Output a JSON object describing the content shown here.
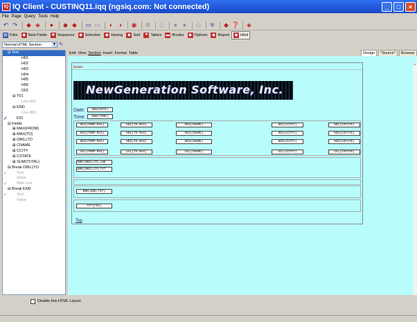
{
  "window": {
    "title": "IQ Client - CUSTINQ11.iqq  (ngsiq.com: Not connected)",
    "icon_label": "IQ"
  },
  "menu": [
    "File",
    "Page",
    "Query",
    "Tools",
    "Help"
  ],
  "toolbar2": [
    "Files",
    "New Fields",
    "Sequence",
    "Selection",
    "Having",
    "Sort",
    "Tables",
    "Breaks",
    "Options",
    "Report",
    "Html"
  ],
  "section_select": {
    "value": "Normal HTML Section"
  },
  "tree": [
    {
      "label": "Text",
      "indent": 1,
      "selected": true,
      "toggle": "⊟"
    },
    {
      "label": "H01",
      "indent": 3
    },
    {
      "label": "H02",
      "indent": 3
    },
    {
      "label": "H03",
      "indent": 3
    },
    {
      "label": "H04",
      "indent": 3
    },
    {
      "label": "H05",
      "indent": 3
    },
    {
      "label": "H06",
      "indent": 3
    },
    {
      "label": "D01",
      "indent": 3
    },
    {
      "label": "T01",
      "indent": 2,
      "toggle": "⊟"
    },
    {
      "label": "Line 801",
      "indent": 3,
      "dim": true
    },
    {
      "label": "END",
      "indent": 2,
      "toggle": "⊟"
    },
    {
      "label": "Line 801",
      "indent": 3,
      "dim": true
    },
    {
      "label": "F01",
      "indent": 2,
      "check": true
    },
    {
      "label": "Fields",
      "indent": 1,
      "toggle": "⊟"
    },
    {
      "label": "MAX(FROM)",
      "indent": 2,
      "toggle": "⊞"
    },
    {
      "label": "MAX(TO)",
      "indent": 2,
      "toggle": "⊞"
    },
    {
      "label": "OBILLTO",
      "indent": 2,
      "toggle": "⊞"
    },
    {
      "label": "CNAME",
      "indent": 2,
      "toggle": "⊞"
    },
    {
      "label": "CCITY",
      "indent": 2,
      "toggle": "⊞"
    },
    {
      "label": "CSTATE",
      "indent": 2,
      "toggle": "⊞"
    },
    {
      "label": "SUM(TOTAL)",
      "indent": 2,
      "toggle": "⊞"
    },
    {
      "label": "Break OBILLTO",
      "indent": 1,
      "toggle": "⊟"
    },
    {
      "label": "Text",
      "indent": 2,
      "dim": true,
      "check": true
    },
    {
      "label": "Value",
      "indent": 2,
      "dim": true
    },
    {
      "label": "Web Link",
      "indent": 2,
      "dim": true,
      "check": true
    },
    {
      "label": "Break END",
      "indent": 1,
      "toggle": "⊟"
    },
    {
      "label": "Text",
      "indent": 2,
      "dim": true,
      "check": true
    },
    {
      "label": "Value",
      "indent": 2,
      "dim": true
    }
  ],
  "pane_menu": [
    "Edit",
    "View",
    "Section",
    "Insert",
    "Format",
    "Table"
  ],
  "tabs": [
    "Design",
    "*Source*",
    "Browser"
  ],
  "doc": {
    "section_label": "Detailz",
    "banner": "NewGeneration Software, Inc.",
    "date_label": "Date:",
    "date_field": "HNU(DATE)",
    "time_label": "Time:",
    "time_field": "HNU(TIME)",
    "rows": [
      [
        "HD1(FROM-MAX)",
        "HD1(TO-MAX)",
        "HD1(CNAME)",
        "HD1(CCITY)",
        "HD1(CSTATE)"
      ],
      [
        "HD2(FROM-MAX)",
        "HD2(TO-MAX)",
        "HD2(CNAME)",
        "HD2(CCITY)",
        "HD2(CSTATE)"
      ],
      [
        "HD3(FROM-MAX)",
        "HD3(TO-MAX)",
        "HD3(CNAME)",
        "HD3(CCITY)",
        "HD3(CSTATE)"
      ],
      [
        "VAL(FROM-MAX)",
        "VAL(TO-MAX)",
        "VAL(CNAME)",
        "VAL(CCITY)",
        "VAL(CSTATE)"
      ]
    ],
    "brk1": "BRK(OBILLTO,LNK",
    "brk2": "BRK(OBILLTO,TXT",
    "brk3": "BRK(END,TXT)",
    "txt": "TXT(F01)",
    "top_link": "Top"
  },
  "bottom": {
    "checkbox_label": "Disable this HTML Layout"
  }
}
